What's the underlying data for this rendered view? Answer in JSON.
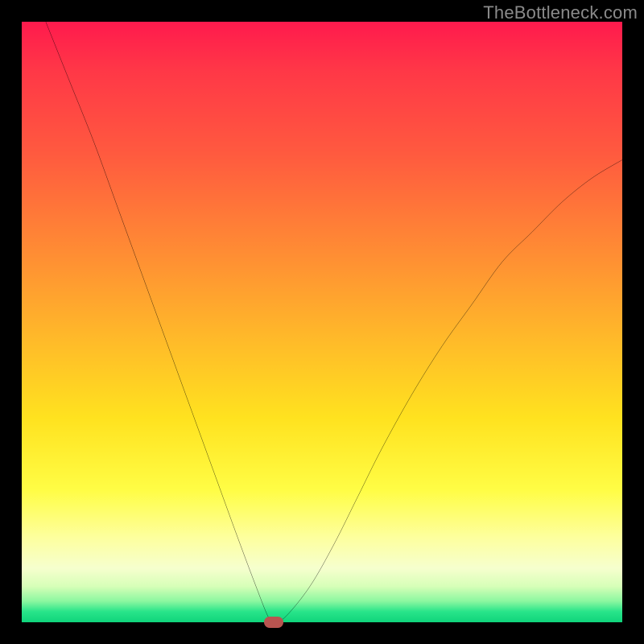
{
  "watermark": "TheBottleneck.com",
  "chart_data": {
    "type": "line",
    "title": "",
    "xlabel": "",
    "ylabel": "",
    "xlim": [
      0,
      100
    ],
    "ylim": [
      0,
      100
    ],
    "grid": false,
    "curve_note": "V-shaped bottleneck curve; minimum at ~x=42, y=0",
    "x": [
      4,
      8,
      12,
      16,
      20,
      24,
      28,
      32,
      36,
      39,
      41,
      42,
      44,
      48,
      52,
      56,
      60,
      65,
      70,
      75,
      80,
      85,
      90,
      95,
      100
    ],
    "y": [
      100,
      90,
      80,
      69,
      58,
      47,
      36,
      25,
      14,
      6,
      1,
      0,
      1,
      6,
      13,
      21,
      29,
      38,
      46,
      53,
      60,
      65,
      70,
      74,
      77
    ],
    "marker": {
      "x": 42,
      "y": 0,
      "color": "#b85450"
    },
    "background_gradient": {
      "top": "#ff1a4d",
      "mid": "#ffe21f",
      "bottom": "#0fd47b"
    }
  }
}
